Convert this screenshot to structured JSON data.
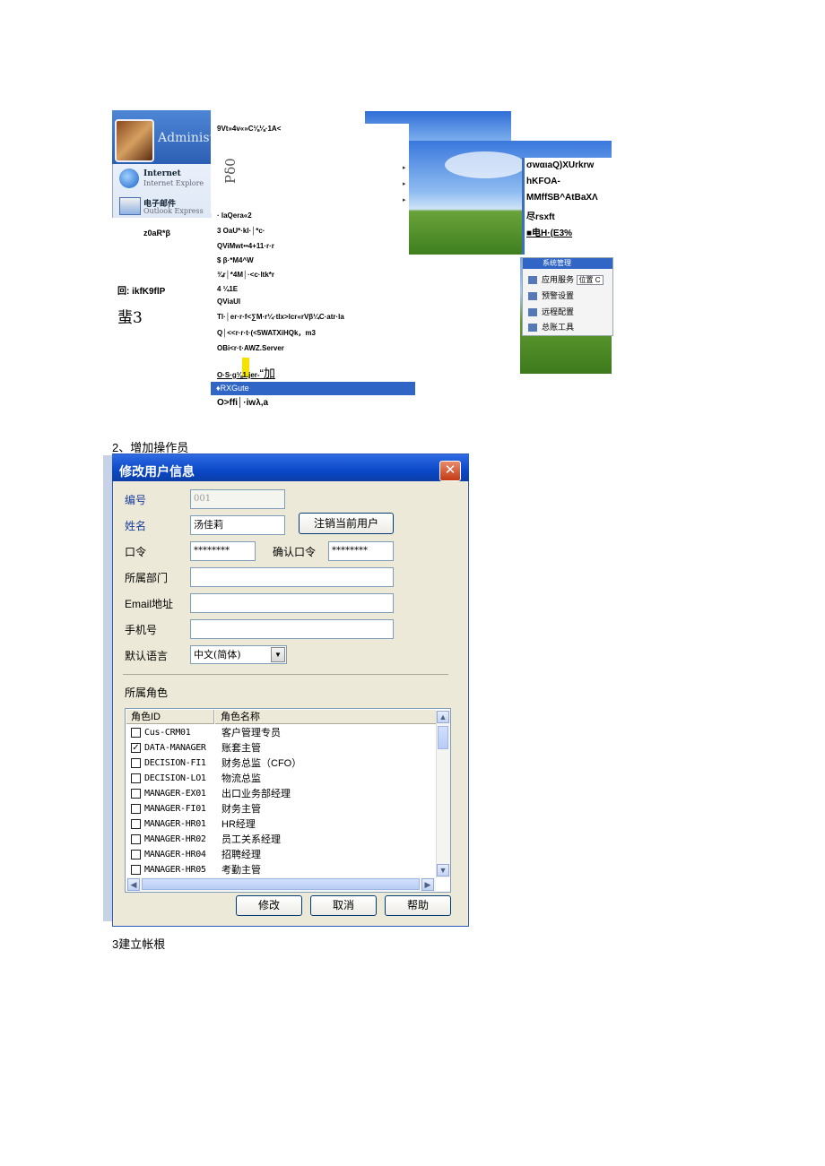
{
  "top_menu": {
    "admin_label": "Administ",
    "ie_line1": "Internet",
    "ie_line2": "Internet Explore",
    "mail_line1": "电子邮件",
    "mail_line2": "Outlook Express",
    "left_bottom_text": "z0aR*β",
    "left_misc1": "回: ikfK9flP",
    "left_misc2": "蜚3",
    "header": "9Vt»4v«»C⅛⅛·1A<",
    "vertical": "Pδ0",
    "items": [
      "· laQera«2",
      "3    OaU*·kl·│*c·",
      "QViMwt••4+11·r·r",
      "$                  β·*M4^W",
      "¾r│*4M│·<c·ltk*r",
      "4      ¼1E",
      "QViaUl",
      "Tl·│er·r·f<∑M·r¼·tlx>lcr«rVβ¼C·atr·la",
      "Q│<<r·r·t·(<5WATXiHQk，m3",
      "OBi<r·t·AWZ.Server"
    ],
    "underlined_item": "O·S·g⅛1.jer-",
    "underlined_suffix": "“加",
    "selected_item": "♦RXGute",
    "last_item": "O>ffi│·iwλ,a",
    "submenu": [
      "σwαιaQ)XUrkrw",
      "hKFOA-",
      "MMffSB^AtBaXΛ",
      "尽rsxft",
      "■电H·(E3%"
    ],
    "sys_menu": {
      "header": "系统管理",
      "items": [
        "应用服务",
        "预警设置",
        "远程配置",
        "总账工具"
      ],
      "field_text": "位置 C"
    }
  },
  "section2_heading": "2、增加操作员",
  "dialog": {
    "title": "修改用户信息",
    "close_glyph": "✕",
    "labels": {
      "code": "编号",
      "name": "姓名",
      "password": "口令",
      "confirm_password": "确认口令",
      "department": "所属部门",
      "email": "Email地址",
      "mobile": "手机号",
      "language": "默认语言",
      "roles": "所属角色"
    },
    "values": {
      "code": "001",
      "name": "汤佳莉",
      "password": "********",
      "confirm_password": "********",
      "department": "",
      "email": "",
      "mobile": "",
      "language": "中文(简体)"
    },
    "logout_button": "注销当前用户",
    "role_table": {
      "columns": [
        "角色ID",
        "角色名称"
      ],
      "rows": [
        {
          "id": "Cus-CRM01",
          "name": "客户管理专员",
          "checked": false
        },
        {
          "id": "DATA-MANAGER",
          "name": "账套主管",
          "checked": true
        },
        {
          "id": "DECISION-FI1",
          "name": "财务总监（CFO）",
          "checked": false
        },
        {
          "id": "DECISION-LO1",
          "name": "物流总监",
          "checked": false
        },
        {
          "id": "MANAGER-EX01",
          "name": "出口业务部经理",
          "checked": false
        },
        {
          "id": "MANAGER-FI01",
          "name": "财务主管",
          "checked": false
        },
        {
          "id": "MANAGER-HR01",
          "name": "HR经理",
          "checked": false
        },
        {
          "id": "MANAGER-HR02",
          "name": "员工关系经理",
          "checked": false
        },
        {
          "id": "MANAGER-HR04",
          "name": "招聘经理",
          "checked": false
        },
        {
          "id": "MANAGER-HR05",
          "name": "考勤主管",
          "checked": false
        }
      ]
    },
    "buttons": {
      "modify": "修改",
      "cancel": "取消",
      "help": "帮助"
    }
  },
  "section3_heading": "3建立帐根",
  "colors": {
    "title_bar": "#0a48c8",
    "dialog_bg": "#ece9d8",
    "selection": "#2f66c6",
    "highlight": "#f4e300"
  }
}
